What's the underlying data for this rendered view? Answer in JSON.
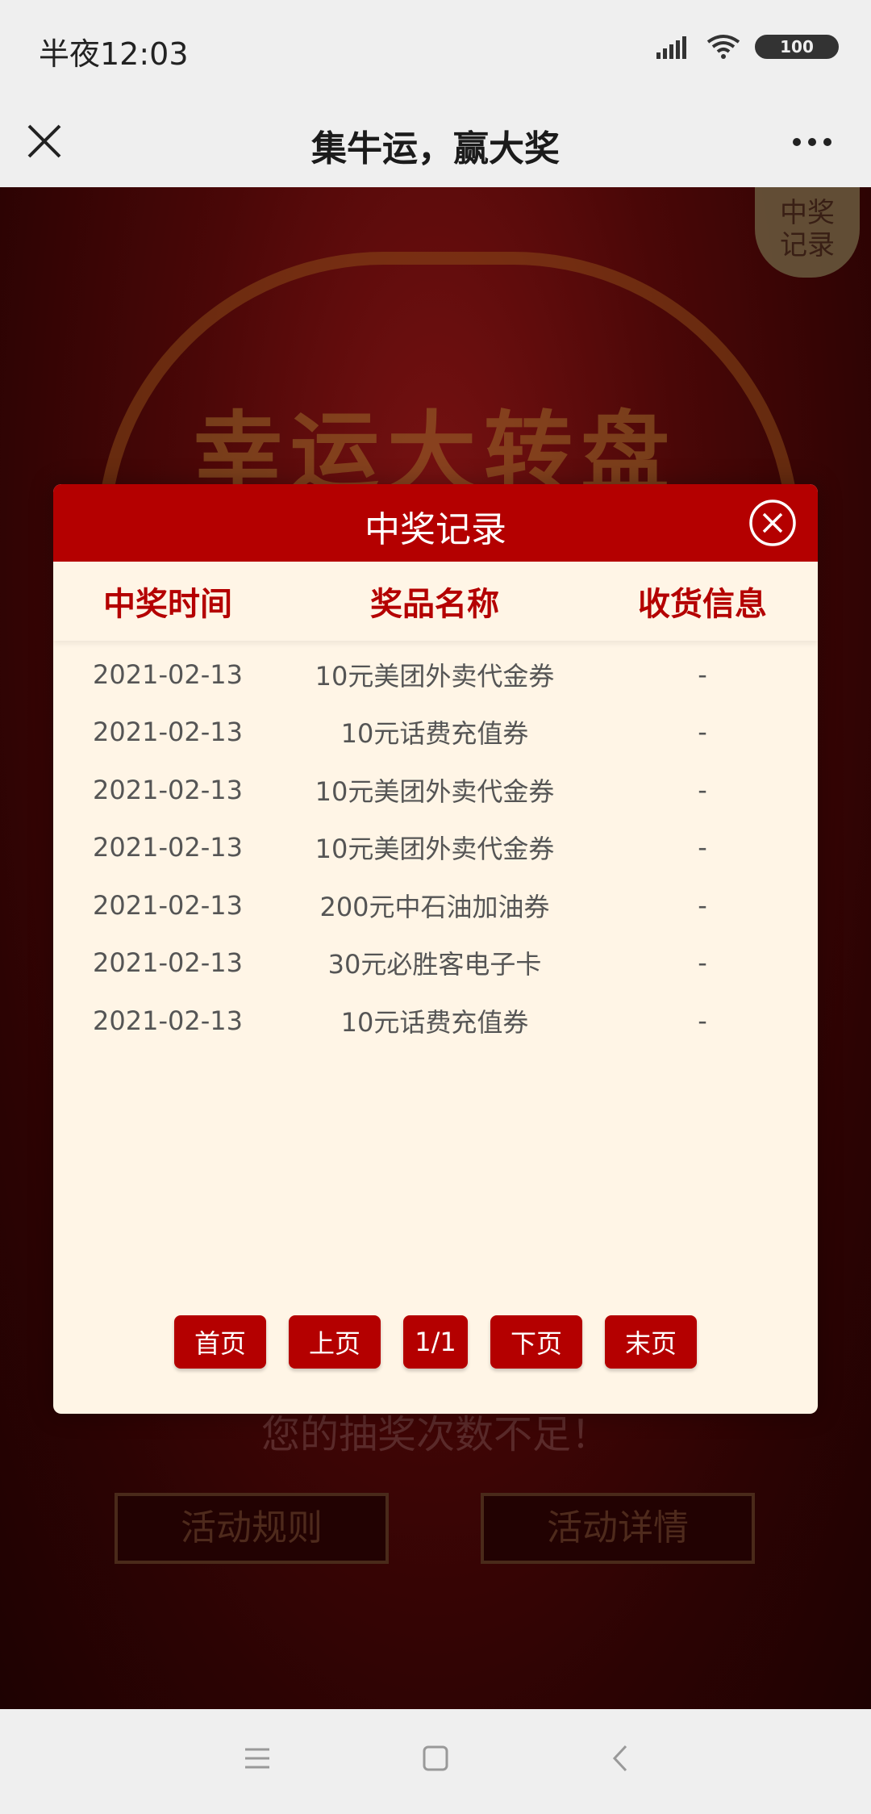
{
  "status_bar": {
    "time": "半夜12:03",
    "battery": "100"
  },
  "header": {
    "title": "集牛运，赢大奖"
  },
  "background": {
    "banner": "幸运大转盘",
    "records_badge": [
      "中奖",
      "记录"
    ],
    "notice": "您的抽奖次数不足！",
    "rules_button": "活动规则",
    "details_button": "活动详情"
  },
  "modal": {
    "title": "中奖记录",
    "columns": [
      "中奖时间",
      "奖品名称",
      "收货信息"
    ],
    "rows": [
      {
        "time": "2021-02-13",
        "prize": "10元美团外卖代金券",
        "shipping": "-"
      },
      {
        "time": "2021-02-13",
        "prize": "10元话费充值券",
        "shipping": "-"
      },
      {
        "time": "2021-02-13",
        "prize": "10元美团外卖代金券",
        "shipping": "-"
      },
      {
        "time": "2021-02-13",
        "prize": "10元美团外卖代金券",
        "shipping": "-"
      },
      {
        "time": "2021-02-13",
        "prize": "200元中石油加油券",
        "shipping": "-"
      },
      {
        "time": "2021-02-13",
        "prize": "30元必胜客电子卡",
        "shipping": "-"
      },
      {
        "time": "2021-02-13",
        "prize": "10元话费充值券",
        "shipping": "-"
      }
    ],
    "pagination": {
      "first": "首页",
      "prev": "上页",
      "page": "1/1",
      "next": "下页",
      "last": "末页"
    }
  },
  "colors": {
    "accent": "#b40000",
    "modal_bg": "#fff5e6"
  }
}
